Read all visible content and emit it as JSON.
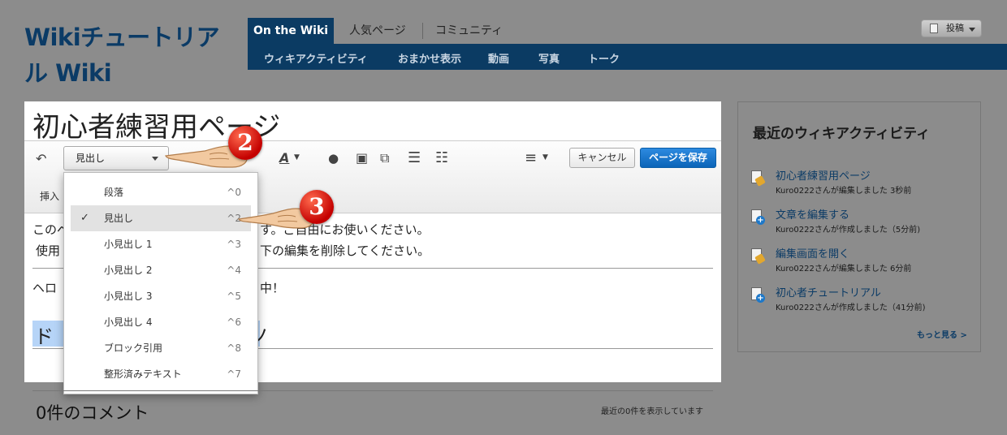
{
  "wiki": {
    "title": "Wikiチュートリアル Wiki"
  },
  "nav": {
    "tabs": [
      {
        "label": "On the Wiki",
        "active": true
      },
      {
        "label": "人気ページ"
      },
      {
        "label": "コミュニティ"
      }
    ],
    "subnav": [
      "ウィキアクティビティ",
      "おまかせ表示",
      "動画",
      "写真",
      "トーク"
    ]
  },
  "header": {
    "post_button": "投稿"
  },
  "editor": {
    "page_title": "初心者練習用ページ",
    "format_select": "見出し",
    "insert_label": "挿入",
    "cancel_button": "キャンセル",
    "save_button": "ページを保存",
    "body_lines": [
      "このペ",
      "す。ご自由にお使いください。",
      "使用",
      "下の編集を削除してください。",
      "ヘロ",
      "中！",
      "ド",
      "ノ"
    ]
  },
  "format_menu": {
    "items": [
      {
        "label": "段落",
        "shortcut": "^0",
        "checked": false
      },
      {
        "label": "見出し",
        "shortcut": "^2",
        "checked": true
      },
      {
        "label": "小見出し 1",
        "shortcut": "^3",
        "checked": false
      },
      {
        "label": "小見出し 2",
        "shortcut": "^4",
        "checked": false
      },
      {
        "label": "小見出し 3",
        "shortcut": "^5",
        "checked": false
      },
      {
        "label": "小見出し 4",
        "shortcut": "^6",
        "checked": false
      },
      {
        "label": "ブロック引用",
        "shortcut": "^8",
        "checked": false
      },
      {
        "label": "整形済みテキスト",
        "shortcut": "^7",
        "checked": false
      }
    ],
    "check_mark": "✓"
  },
  "annotations": {
    "step2": "2",
    "step3": "3"
  },
  "comments": {
    "title": "0件のコメント",
    "note": "最近の0件を表示しています"
  },
  "sidebar": {
    "title": "最近のウィキアクティビティ",
    "items": [
      {
        "link": "初心者練習用ページ",
        "meta": "Kuro0222さんが編集しました 3秒前",
        "icon": "edit-page-icon"
      },
      {
        "link": "文章を編集する",
        "meta": "Kuro0222さんが作成しました（5分前)",
        "icon": "new-page-icon"
      },
      {
        "link": "編集画面を開く",
        "meta": "Kuro0222さんが編集しました 6分前",
        "icon": "edit-page-icon"
      },
      {
        "link": "初心者チュートリアル",
        "meta": "Kuro0222さんが作成しました（41分前)",
        "icon": "new-page-icon"
      }
    ],
    "more_link": "もっと見る >"
  }
}
